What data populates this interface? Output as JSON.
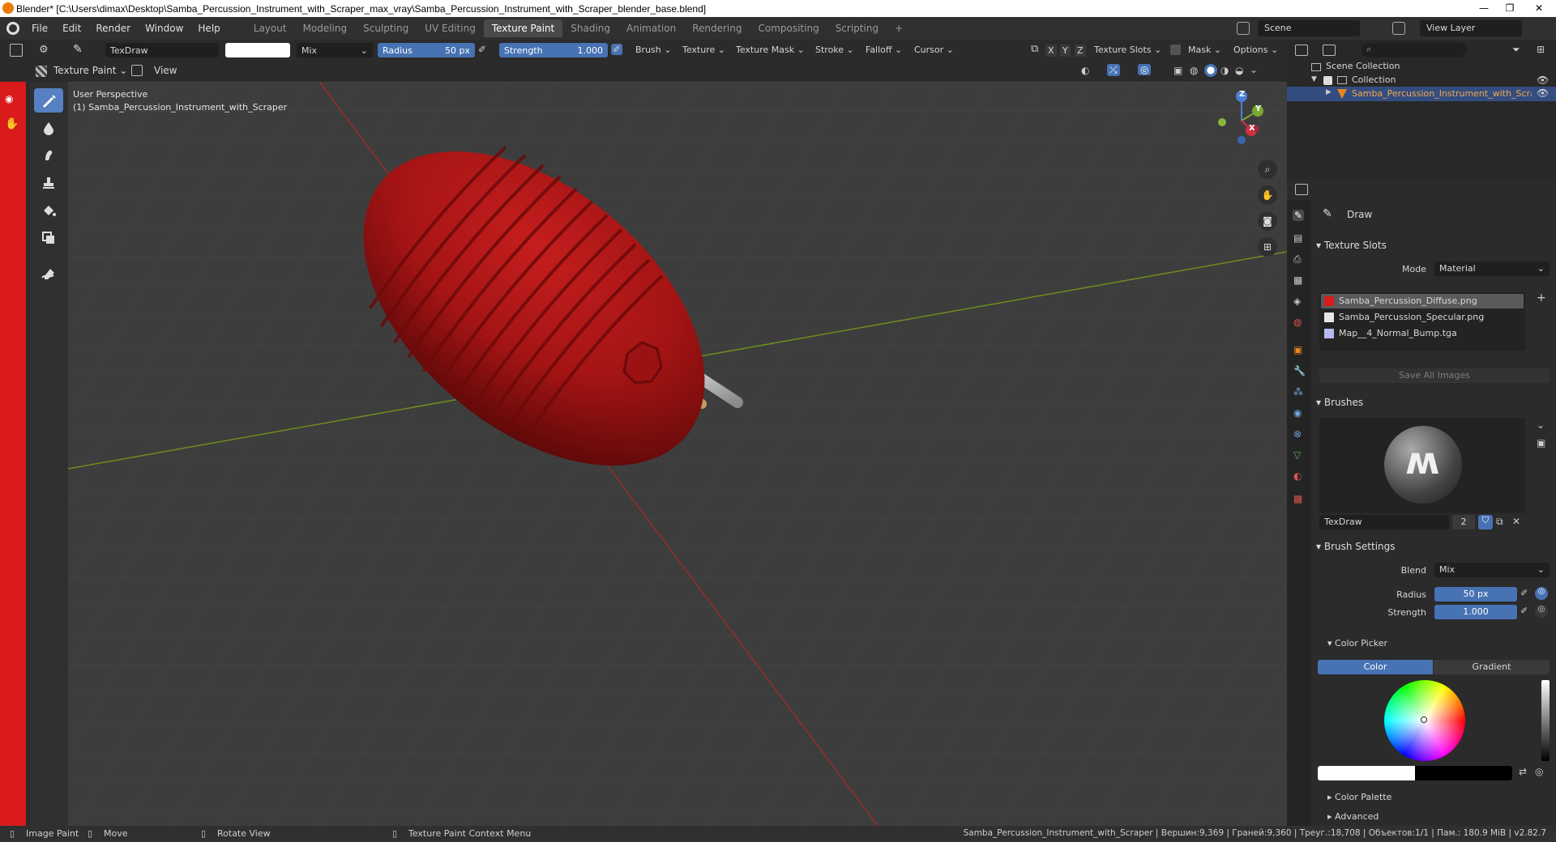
{
  "window": {
    "title": "Blender* [C:\\Users\\dimax\\Desktop\\Samba_Percussion_Instrument_with_Scraper_max_vray\\Samba_Percussion_Instrument_with_Scraper_blender_base.blend]",
    "minimize": "—",
    "maximize": "❐",
    "close": "✕"
  },
  "menu": [
    "File",
    "Edit",
    "Render",
    "Window",
    "Help"
  ],
  "workspaces": [
    "Layout",
    "Modeling",
    "Sculpting",
    "UV Editing",
    "Texture Paint",
    "Shading",
    "Animation",
    "Rendering",
    "Compositing",
    "Scripting",
    "+"
  ],
  "active_workspace": "Texture Paint",
  "scene": {
    "name": "Scene",
    "view_layer": "View Layer"
  },
  "toolheader": {
    "brush_name": "TexDraw",
    "blend": "Mix",
    "radius_label": "Radius",
    "radius_value": "50 px",
    "strength_label": "Strength",
    "strength_value": "1.000",
    "dropdowns": [
      "Brush",
      "Texture",
      "Texture Mask",
      "Stroke",
      "Falloff",
      "Cursor"
    ],
    "axis": [
      "X",
      "Y",
      "Z"
    ],
    "texture_slots": "Texture Slots",
    "mask": "Mask",
    "options": "Options"
  },
  "modeheader": {
    "mode": "Texture Paint",
    "view": "View"
  },
  "viewport": {
    "perspective": "User Perspective",
    "object_label": "(1) Samba_Percussion_Instrument_with_Scraper",
    "gizmo": {
      "x": "X",
      "y": "Y",
      "z": "Z"
    }
  },
  "outliner": {
    "search_placeholder": "",
    "scene_collection": "Scene Collection",
    "collection": "Collection",
    "object": "Samba_Percussion_Instrument_with_Scraper"
  },
  "properties": {
    "tool_name": "Draw",
    "texture_slots_title": "Texture Slots",
    "mode_label": "Mode",
    "mode_value": "Material",
    "slots": [
      {
        "name": "Samba_Percussion_Diffuse.png",
        "color": "#d91b1b"
      },
      {
        "name": "Samba_Percussion_Specular.png",
        "color": "#e6e6e6"
      },
      {
        "name": "Map__4_Normal_Bump.tga",
        "color": "#b8b8f0"
      }
    ],
    "save_all": "Save All Images",
    "brushes_title": "Brushes",
    "brush_name": "TexDraw",
    "brush_users": "2",
    "brush_settings_title": "Brush Settings",
    "blend_label": "Blend",
    "blend_value": "Mix",
    "radius_label": "Radius",
    "radius_value": "50 px",
    "strength_label": "Strength",
    "strength_value": "1.000",
    "color_picker_title": "Color Picker",
    "color_tab": "Color",
    "gradient_tab": "Gradient",
    "color_palette": "Color Palette",
    "advanced": "Advanced"
  },
  "status": {
    "image_paint": "Image Paint",
    "move": "Move",
    "rotate_view": "Rotate View",
    "context_menu": "Texture Paint Context Menu",
    "stats": "Samba_Percussion_Instrument_with_Scraper | Вершин:9,369 | Граней:9,360 | Треуг.:18,708 | Объектов:1/1 | Пам.: 180.9 MiB | v2.82.7"
  },
  "colors": {
    "accent": "#4772b3",
    "object_red": "#a41414",
    "paint_red": "#d91b1b"
  }
}
